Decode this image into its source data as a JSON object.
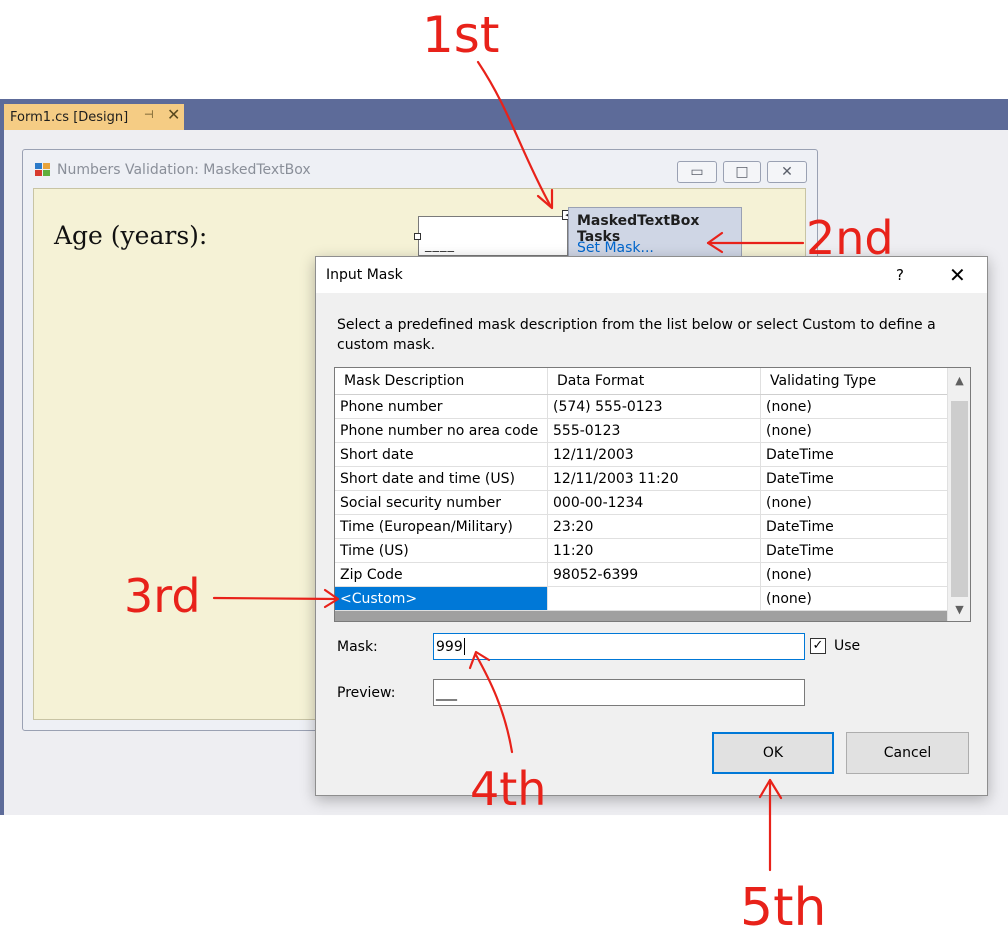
{
  "designer_tab": {
    "label": "Form1.cs [Design]",
    "pin_icon": "pin-icon",
    "close_icon": "close-icon",
    "tab_color": "#f5cc84"
  },
  "form": {
    "title": "Numbers Validation: MaskedTextBox",
    "age_label": "Age (years):",
    "masked_prompt": "____",
    "client_color": "#f5f2d6"
  },
  "tasks_panel": {
    "title": "MaskedTextBox Tasks",
    "set_mask_link": "Set Mask..."
  },
  "dialog": {
    "title": "Input Mask",
    "help": "?",
    "instructions": "Select a predefined mask description from the list below or select Custom to define a custom mask.",
    "columns": [
      "Mask Description",
      "Data Format",
      "Validating Type"
    ],
    "rows": [
      [
        "Phone number",
        "(574) 555-0123",
        "(none)"
      ],
      [
        "Phone number no area code",
        "555-0123",
        "(none)"
      ],
      [
        "Short date",
        "12/11/2003",
        "DateTime"
      ],
      [
        "Short date and time (US)",
        "12/11/2003 11:20",
        "DateTime"
      ],
      [
        "Social security number",
        "000-00-1234",
        "(none)"
      ],
      [
        "Time (European/Military)",
        "23:20",
        "DateTime"
      ],
      [
        "Time (US)",
        "11:20",
        "DateTime"
      ],
      [
        "Zip Code",
        "98052-6399",
        "(none)"
      ],
      [
        "<Custom>",
        "",
        "(none)"
      ]
    ],
    "selected_row": 8,
    "mask_label": "Mask:",
    "mask_value": "999",
    "use_label": "Use",
    "use_checked": "✓",
    "preview_label": "Preview:",
    "preview_value": "___",
    "ok_label": "OK",
    "cancel_label": "Cancel",
    "accent": "#0078d7"
  },
  "annotations": {
    "first": "1st",
    "second": "2nd",
    "third": "3rd",
    "fourth": "4th",
    "fifth": "5th",
    "color": "#e8221a"
  }
}
